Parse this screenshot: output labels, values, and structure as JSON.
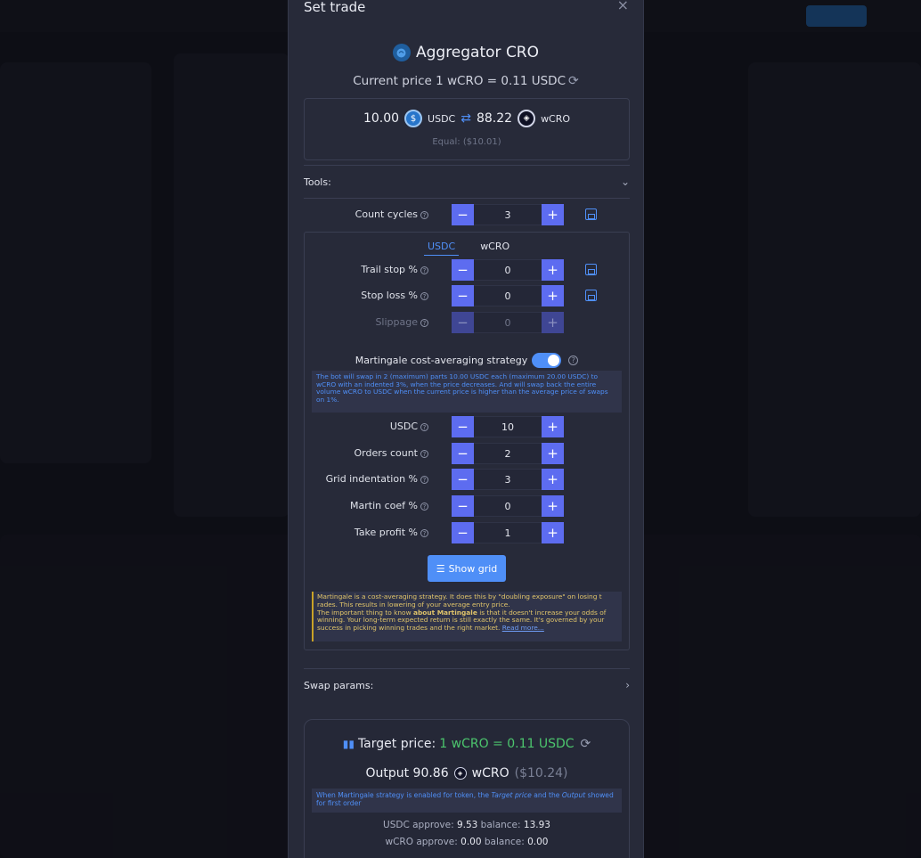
{
  "modal": {
    "title": "Set trade",
    "close": "×",
    "aggregator_title": "Aggregator CRO",
    "current_price": "Current price 1 wCRO = 0.11 USDC",
    "swap": {
      "amount_from": "10.00",
      "token_from": "USDC",
      "amount_to": "88.22",
      "token_to": "wCRO",
      "equal": "Equal: ($10.01)"
    },
    "tools_label": "Tools:",
    "swap_params_label": "Swap params:",
    "count_cycles": {
      "label": "Count cycles",
      "value": "3"
    },
    "tabs": [
      "USDC",
      "wCRO"
    ],
    "params_top": [
      {
        "label": "Trail stop %",
        "value": "0"
      },
      {
        "label": "Stop loss %",
        "value": "0"
      },
      {
        "label": "Slippage",
        "value": "0"
      }
    ],
    "martingale_label": "Martingale cost-averaging strategy",
    "martingale_enabled": true,
    "martingale_info": "The bot will swap in 2 (maximum) parts 10.00 USDC each (maximum 20.00 USDC) to wCRO with an indented 3%, when the price decreases. And will swap back the entire volume wCRO to USDC when the current price is higher than the average price of swaps on 1%.",
    "params_martingale": [
      {
        "label": "USDC",
        "value": "10"
      },
      {
        "label": "Orders count",
        "value": "2"
      },
      {
        "label": "Grid indentation %",
        "value": "3"
      },
      {
        "label": "Martin coef %",
        "value": "0"
      },
      {
        "label": "Take profit %",
        "value": "1"
      }
    ],
    "show_grid_label": "Show grid",
    "martingale_warning_1": "Martingale is a cost-averaging strategy. It does this by \"doubling exposure\" on losing t rades. This results in lowering of your average entry price.",
    "martingale_warning_2a": "The important thing to know ",
    "martingale_warning_2b": "about Martingale",
    "martingale_warning_2c": " is that it doesn't increase your odds of winning. Your long-term expected return is still exactly the same. It's governed by your success in picking winning trades and the right market. ",
    "read_more": "Read more...",
    "target_price_label": "Target price:",
    "target_price_value": "1 wCRO = 0.11 USDC",
    "output_label": "Output 90.86",
    "output_token": "wCRO",
    "output_usd": "($10.24)",
    "note_1": "When Martingale strategy is enabled for token, the ",
    "note_target": "Target price",
    "note_2": " and the ",
    "note_output": "Output",
    "note_3": " showed for first order",
    "usdc_approve": "USDC approve: ",
    "usdc_approve_val": "9.53",
    "usdc_balance": " balance: ",
    "usdc_balance_val": "13.93",
    "wcro_approve": "wCRO approve: ",
    "wcro_approve_val": "0.00",
    "wcro_balance": " balance: ",
    "wcro_balance_val": "0.00"
  },
  "colors": {
    "accent": "#4f8ff7",
    "stepper": "#5d6cf0",
    "positive": "#4cc56d",
    "warning": "#e1c56a"
  }
}
